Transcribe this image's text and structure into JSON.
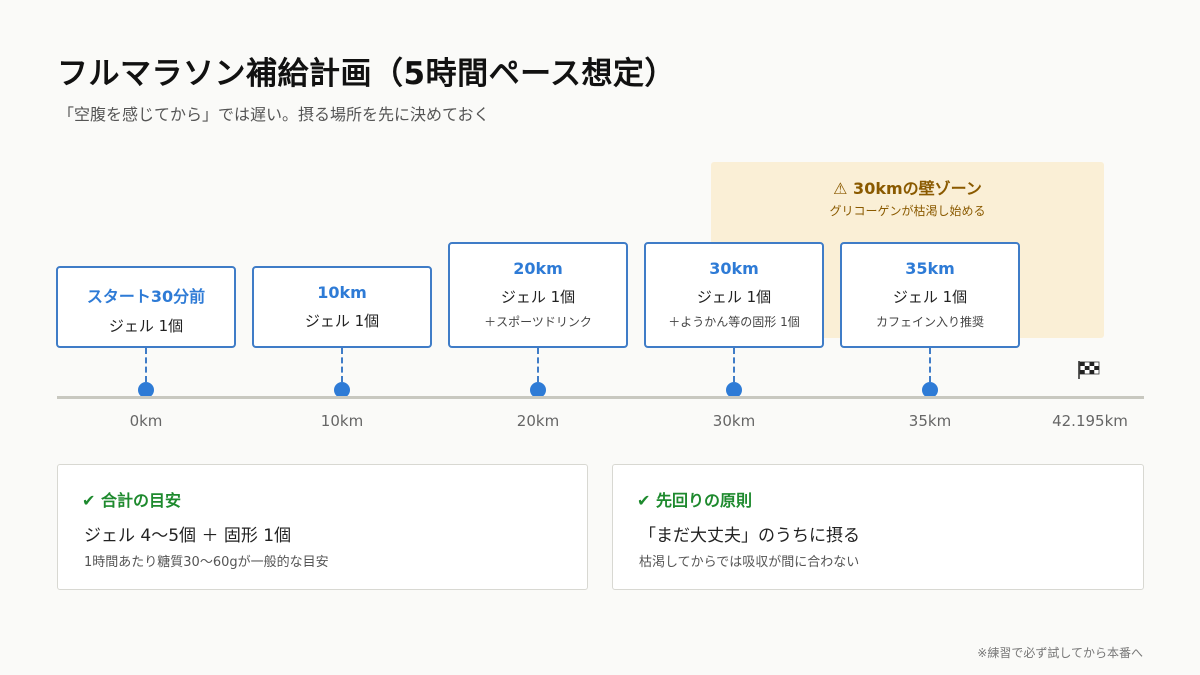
{
  "title": "フルマラソン補給計画（5時間ペース想定）",
  "subtitle": "「空腹を感じてから」では遅い。摂る場所を先に決めておく",
  "wall_zone": {
    "title": "⚠ 30kmの壁ゾーン",
    "subtitle": "グリコーゲンが枯渇し始める"
  },
  "stations": [
    {
      "distance": "スタート30分前",
      "main": "ジェル 1個",
      "sub": ""
    },
    {
      "distance": "10km",
      "main": "ジェル 1個",
      "sub": ""
    },
    {
      "distance": "20km",
      "main": "ジェル 1個",
      "sub": "＋スポーツドリンク"
    },
    {
      "distance": "30km",
      "main": "ジェル 1個",
      "sub": "＋ようかん等の固形 1個"
    },
    {
      "distance": "35km",
      "main": "ジェル 1個",
      "sub": "カフェイン入り推奨"
    }
  ],
  "axis_labels": [
    "0km",
    "10km",
    "20km",
    "30km",
    "35km",
    "42.195km"
  ],
  "finish_icon": "checkered-flag-icon",
  "summary": {
    "heading": "✔ 合計の目安",
    "main": "ジェル 4〜5個 ＋ 固形 1個",
    "sub": "1時間あたり糖質30〜60gが一般的な目安"
  },
  "principle": {
    "heading": "✔ 先回りの原則",
    "main": "「まだ大丈夫」のうちに摂る",
    "sub": "枯渇してからでは吸収が間に合わない"
  },
  "footnote": "※練習で必ず試してから本番へ",
  "colors": {
    "accent": "#2e7bd6",
    "warning_bg": "#faefd6",
    "warning_text": "#8a5a00",
    "success": "#1e8a2e"
  }
}
